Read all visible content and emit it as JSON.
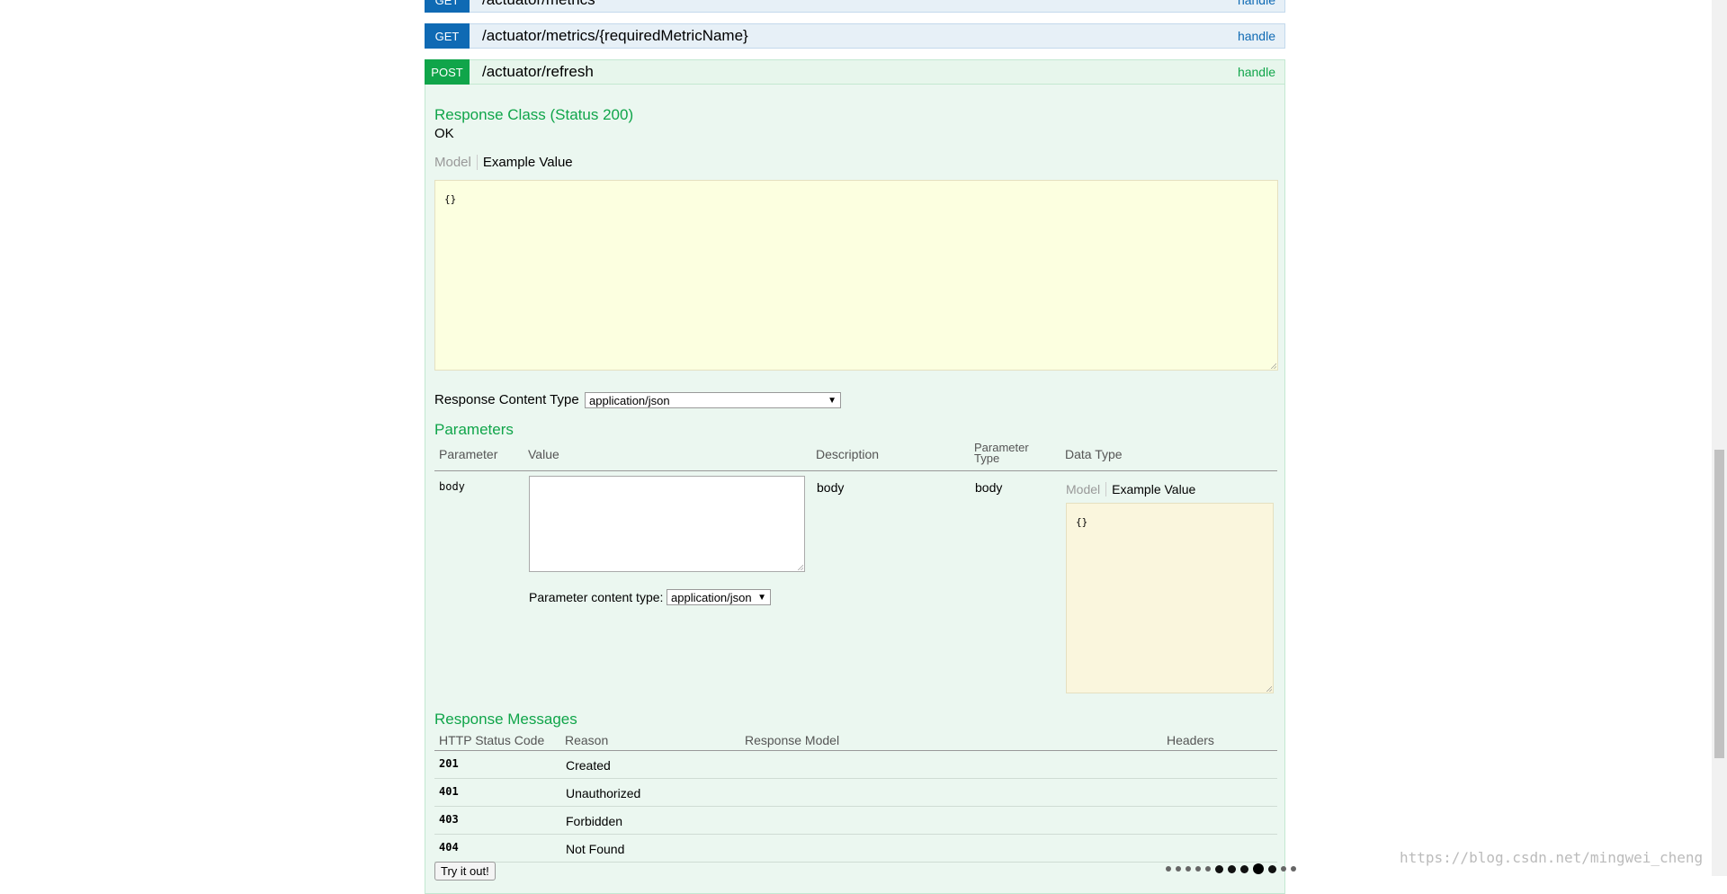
{
  "operations": [
    {
      "verb": "GET",
      "path": "/actuator/metrics",
      "handle": "handle"
    },
    {
      "verb": "GET",
      "path": "/actuator/metrics/{requiredMetricName}",
      "handle": "handle"
    },
    {
      "verb": "POST",
      "path": "/actuator/refresh",
      "handle": "handle"
    }
  ],
  "response_class": {
    "title": "Response Class (Status 200)",
    "status_text": "OK"
  },
  "tabs": {
    "model": "Model",
    "example": "Example Value"
  },
  "example_code": "{}",
  "response_content_type": {
    "label": "Response Content Type",
    "value": "application/json"
  },
  "parameters": {
    "title": "Parameters",
    "headers": {
      "parameter": "Parameter",
      "value": "Value",
      "description": "Description",
      "param_type_1": "Parameter",
      "param_type_2": "Type",
      "data_type": "Data Type"
    },
    "row": {
      "name": "body",
      "description": "body",
      "param_type": "body"
    },
    "content_type_label": "Parameter content type:",
    "content_type_value": "application/json",
    "example_code": "{}"
  },
  "response_messages": {
    "title": "Response Messages",
    "headers": {
      "status": "HTTP Status Code",
      "reason": "Reason",
      "model": "Response Model",
      "headers": "Headers"
    },
    "rows": [
      {
        "code": "201",
        "reason": "Created"
      },
      {
        "code": "401",
        "reason": "Unauthorized"
      },
      {
        "code": "403",
        "reason": "Forbidden"
      },
      {
        "code": "404",
        "reason": "Not Found"
      }
    ]
  },
  "try_button": "Try it out!",
  "watermark": "https://blog.csdn.net/mingwei_cheng",
  "colors": {
    "get": "#0f6ab4",
    "post": "#10a54a",
    "code_bg": "#fcffe0"
  }
}
